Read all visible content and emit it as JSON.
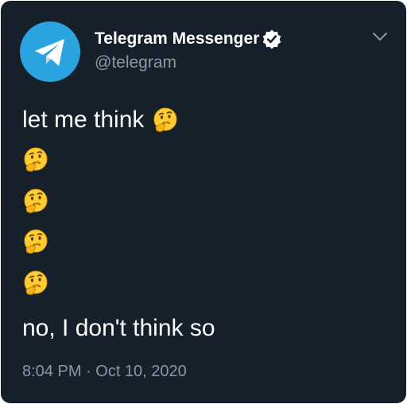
{
  "author": {
    "display_name": "Telegram Messenger",
    "handle": "@telegram",
    "verified": true,
    "avatar_icon": "telegram-paper-plane-icon",
    "avatar_color": "#2BA3DF"
  },
  "menu_icon": "chevron-down-icon",
  "tweet": {
    "line_1": "let me think",
    "line_1_emoji": "thinking-face-icon",
    "emoji_rows": [
      "thinking-face-icon",
      "thinking-face-icon",
      "thinking-face-icon",
      "thinking-face-icon"
    ],
    "line_6": "no, I don't think so"
  },
  "timestamp": "8:04 PM · Oct 10, 2020",
  "colors": {
    "card_background": "#15202B",
    "primary_text": "#FFFFFF",
    "secondary_text": "#8899A6"
  }
}
